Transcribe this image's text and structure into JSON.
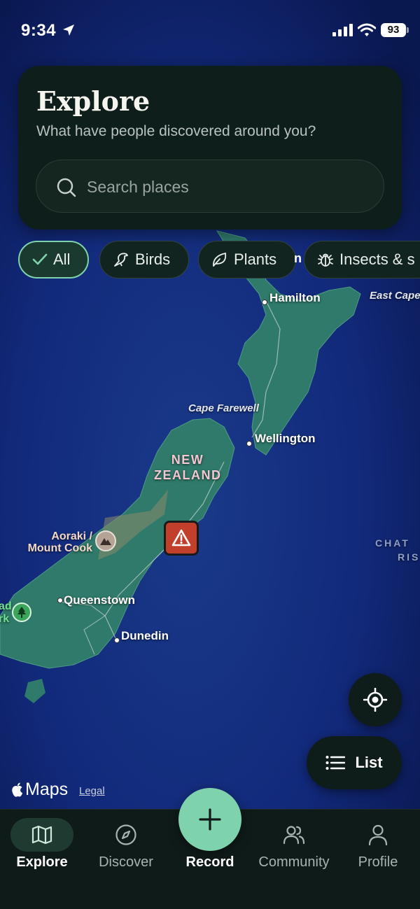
{
  "status_bar": {
    "time": "9:34",
    "battery": "93",
    "icons": [
      "location-arrow-icon",
      "signal-icon",
      "wifi-icon",
      "battery-icon"
    ]
  },
  "explore": {
    "title": "Explore",
    "subtitle": "What have people discovered around you?",
    "search_placeholder": "Search places",
    "search_value": ""
  },
  "filters": [
    {
      "label": "All",
      "icon": "check-icon",
      "selected": true
    },
    {
      "label": "Birds",
      "icon": "bird-icon",
      "selected": false
    },
    {
      "label": "Plants",
      "icon": "leaf-icon",
      "selected": false
    },
    {
      "label": "Insects & s",
      "icon": "bug-icon",
      "selected": false
    }
  ],
  "map": {
    "labels": {
      "hamilton": "Hamilton",
      "east_cape": "East Cape",
      "cape_farewell": "Cape Farewell",
      "wellington": "Wellington",
      "country_line1": "NEW",
      "country_line2": "ZEALAND",
      "aoraki_line1": "Aoraki /",
      "aoraki_line2": "Mount Cook",
      "queenstown": "Queenstown",
      "dunedin": "Dunedin",
      "chatham_line1": "CHAT",
      "chatham_line2": "RIS",
      "park_line1": "ad",
      "park_line2": "rk",
      "hidden_fragment": "n"
    },
    "markers": [
      "hazard-warning-icon",
      "mountain-icon",
      "park-tree-icon"
    ],
    "brand": "Maps",
    "legal": "Legal"
  },
  "controls": {
    "list_label": "List"
  },
  "tabs": [
    {
      "label": "Explore",
      "icon": "map-icon",
      "active": true
    },
    {
      "label": "Discover",
      "icon": "compass-icon",
      "active": false
    },
    {
      "label": "Record",
      "icon": "plus-icon",
      "active": false
    },
    {
      "label": "Community",
      "icon": "people-icon",
      "active": false
    },
    {
      "label": "Profile",
      "icon": "person-icon",
      "active": false
    }
  ],
  "colors": {
    "ocean": "#0d1f5c",
    "land": "#2f7a6a",
    "accent": "#7fd3ac",
    "card": "#0e1e1b",
    "hazard": "#c2402b"
  }
}
